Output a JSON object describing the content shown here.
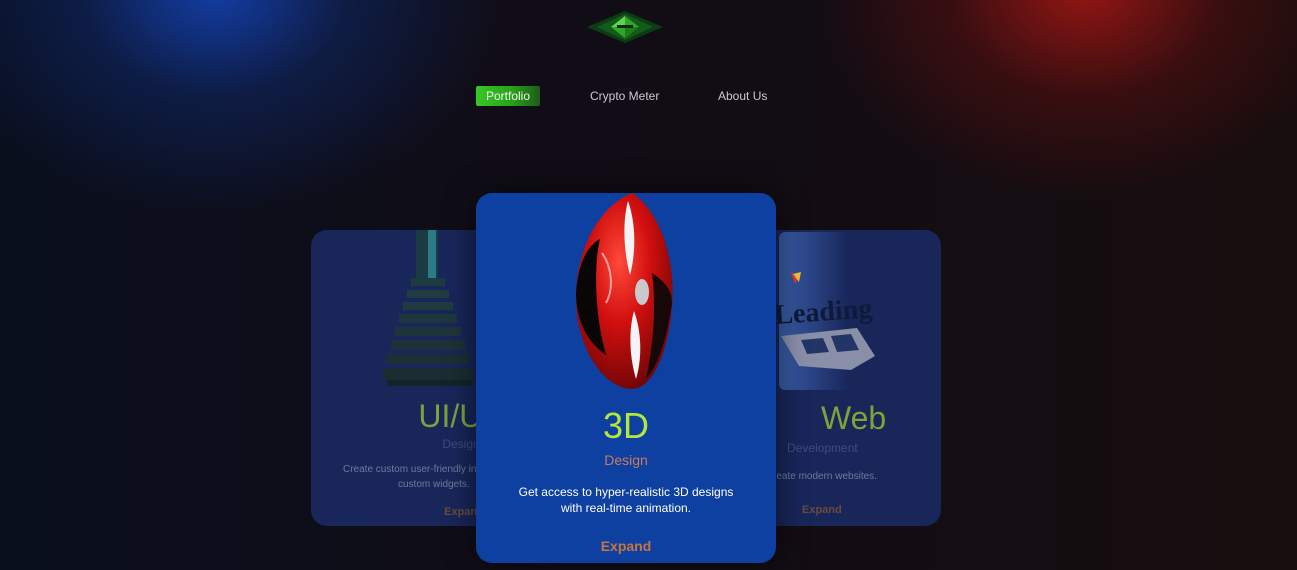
{
  "brand": {
    "logo_icon": "green-diamond-logo-icon",
    "colors": {
      "accent_green": "#38c825",
      "card_blue": "#0d40a0",
      "title_lime": "#b5e63c",
      "expand_orange": "#c8743f"
    }
  },
  "nav": {
    "items": [
      {
        "label": "Portfolio",
        "active": true
      },
      {
        "label": "Crypto Meter",
        "active": false
      },
      {
        "label": "About Us",
        "active": false
      }
    ]
  },
  "cards": {
    "left": {
      "image_icon": "stacked-tower-3d-icon",
      "title": "UI/UX",
      "subtitle": "Design",
      "description": "Create custom user-friendly interfaces and custom widgets.",
      "desc_visible": "Create custom user-friendly inter",
      "desc_line2": "custom widgets.",
      "expand_label": "Expand"
    },
    "center": {
      "image_icon": "red-3d-shield-icon",
      "title": "3D",
      "subtitle": "Design",
      "description_line1": "Get access to hyper-realistic 3D designs",
      "description_line2": "with real-time animation.",
      "expand_label": "Expand"
    },
    "right": {
      "image_icon": "leading-web-poster-icon",
      "title": "Web",
      "subtitle": "Development",
      "description": "reate modern websites.",
      "expand_label": "Expand"
    }
  }
}
